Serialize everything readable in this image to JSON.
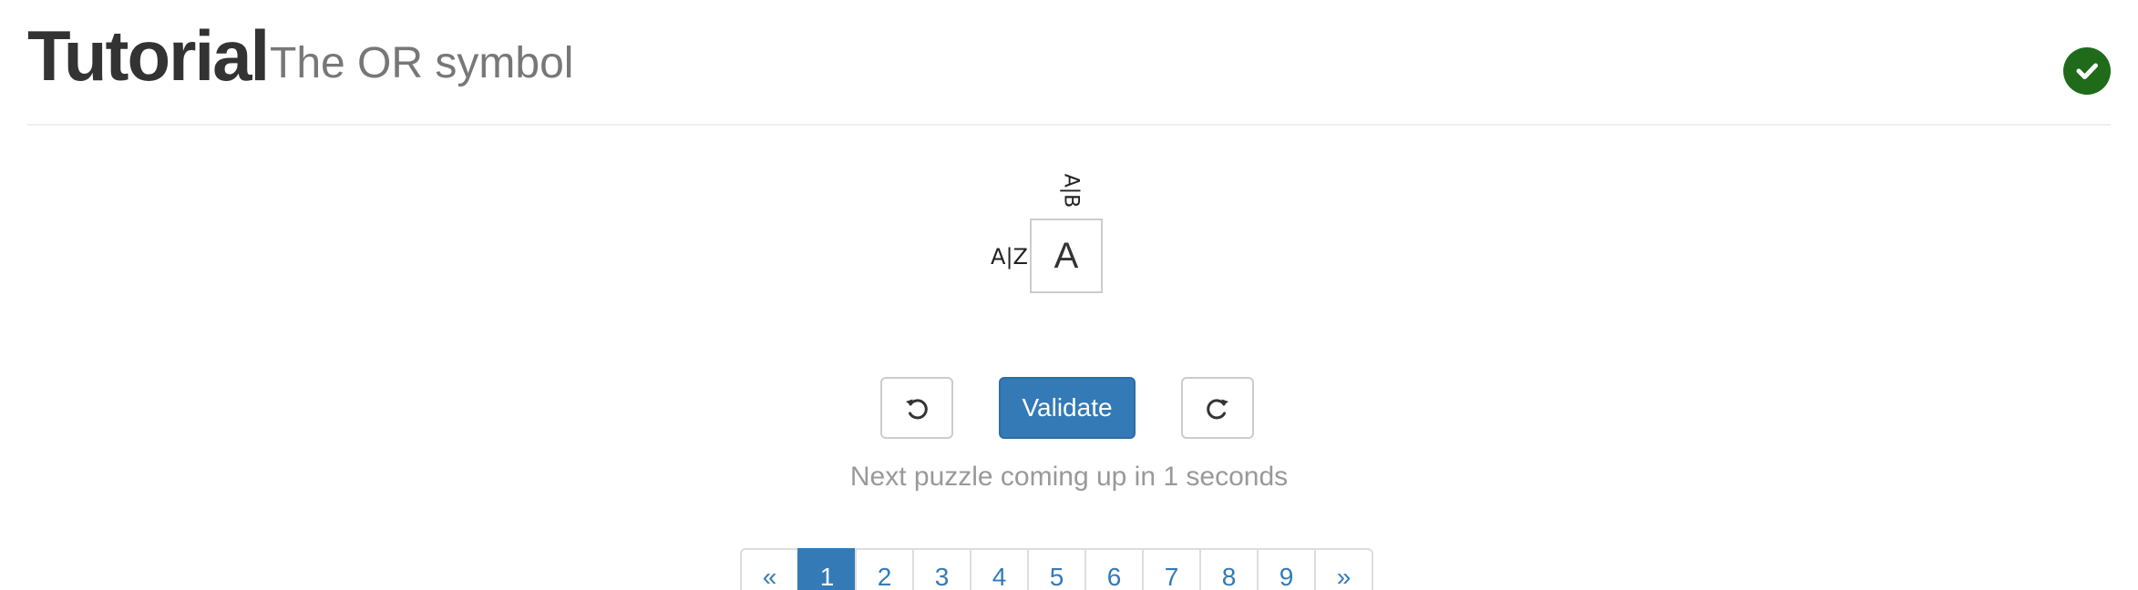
{
  "header": {
    "title": "Tutorial",
    "subtitle": "The OR symbol",
    "solved_icon": "check-circle-icon",
    "solved_color": "#1f6b1a"
  },
  "puzzle": {
    "column_clue": "A|B",
    "row_clue": "A|Z",
    "cell_value": "A"
  },
  "controls": {
    "undo_icon": "undo-icon",
    "validate_label": "Validate",
    "redo_icon": "redo-icon",
    "accent_color": "#337ab7"
  },
  "status": {
    "message": "Next puzzle coming up in 1 seconds"
  },
  "pagination": {
    "prev_label": "«",
    "next_label": "»",
    "pages": [
      "1",
      "2",
      "3",
      "4",
      "5",
      "6",
      "7",
      "8",
      "9"
    ],
    "active_page": "1"
  }
}
